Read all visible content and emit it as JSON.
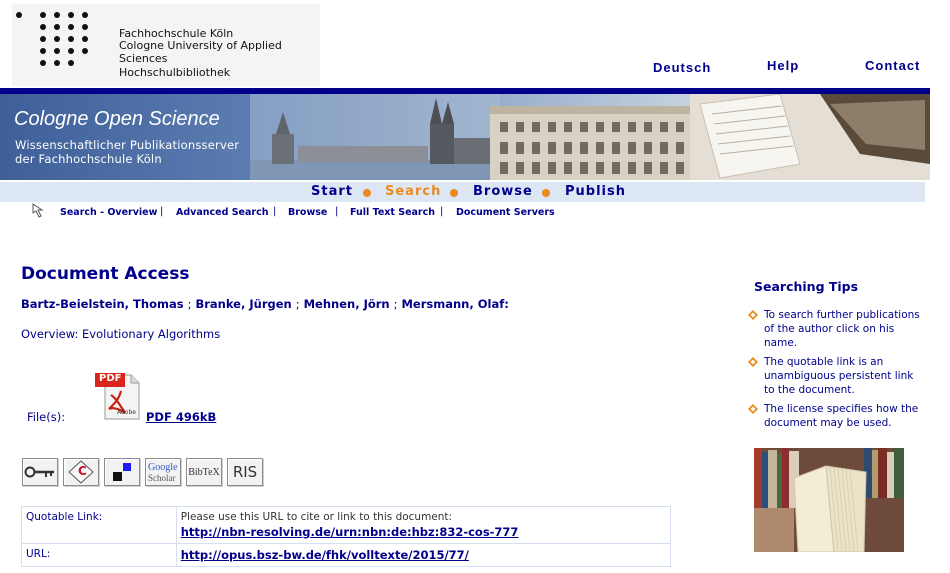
{
  "header": {
    "logo_line1": "Fachhochschule Köln",
    "logo_line2": "Cologne University of Applied Sciences",
    "logo_line3": "Hochschulbibliothek",
    "links": [
      {
        "label": "Deutsch"
      },
      {
        "label": "Help"
      },
      {
        "label": "Contact"
      }
    ]
  },
  "banner": {
    "title": "Cologne Open Science",
    "subtitle_line1": "Wissenschaftlicher Publikationsserver",
    "subtitle_line2": "der Fachhochschule Köln"
  },
  "main_nav": [
    {
      "label": "Start",
      "active": false
    },
    {
      "label": "Search",
      "active": true
    },
    {
      "label": "Browse",
      "active": false
    },
    {
      "label": "Publish",
      "active": false
    }
  ],
  "sub_nav": [
    {
      "label": "Search - Overview"
    },
    {
      "label": "Advanced Search"
    },
    {
      "label": "Browse"
    },
    {
      "label": "Full Text Search"
    },
    {
      "label": "Document Servers"
    }
  ],
  "sub_nav_separator": "|",
  "content": {
    "title": "Document Access",
    "authors": [
      "Bartz-Beielstein, Thomas",
      "Branke, Jürgen",
      "Mehnen, Jörn",
      "Mersmann, Olaf"
    ],
    "author_separator": ";",
    "authors_end": ":",
    "subtitle": "Overview: Evolutionary Algorithms",
    "files_label": "File(s):",
    "pdf_icon_text": "PDF",
    "pdf_icon_brand": "Adobe",
    "pdf_link": "PDF 496kB",
    "tools": [
      {
        "name": "key",
        "label": ""
      },
      {
        "name": "citation",
        "label": "C"
      },
      {
        "name": "squares",
        "label": ""
      },
      {
        "name": "google-scholar",
        "label_1": "Google",
        "label_2": "Scholar"
      },
      {
        "name": "bibtex",
        "label": "BibTeX"
      },
      {
        "name": "ris",
        "label": "RIS"
      }
    ],
    "links_table": [
      {
        "label": "Quotable Link:",
        "note": "Please use this URL to cite or link to this document:",
        "url": "http://nbn-resolving.de/urn:nbn:de:hbz:832-cos-777"
      },
      {
        "label": "URL:",
        "note": "",
        "url": "http://opus.bsz-bw.de/fhk/volltexte/2015/77/"
      }
    ]
  },
  "sidebar": {
    "title": "Searching Tips",
    "tips": [
      "To search further publications of the author click on his name.",
      "The quotable link is an unambiguous persistent link to the document.",
      "The license specifies how the document may be used."
    ]
  },
  "colors": {
    "brand_blue": "#00008b",
    "accent_orange": "#ec8a1d",
    "nav_bg": "#dde7f4"
  }
}
